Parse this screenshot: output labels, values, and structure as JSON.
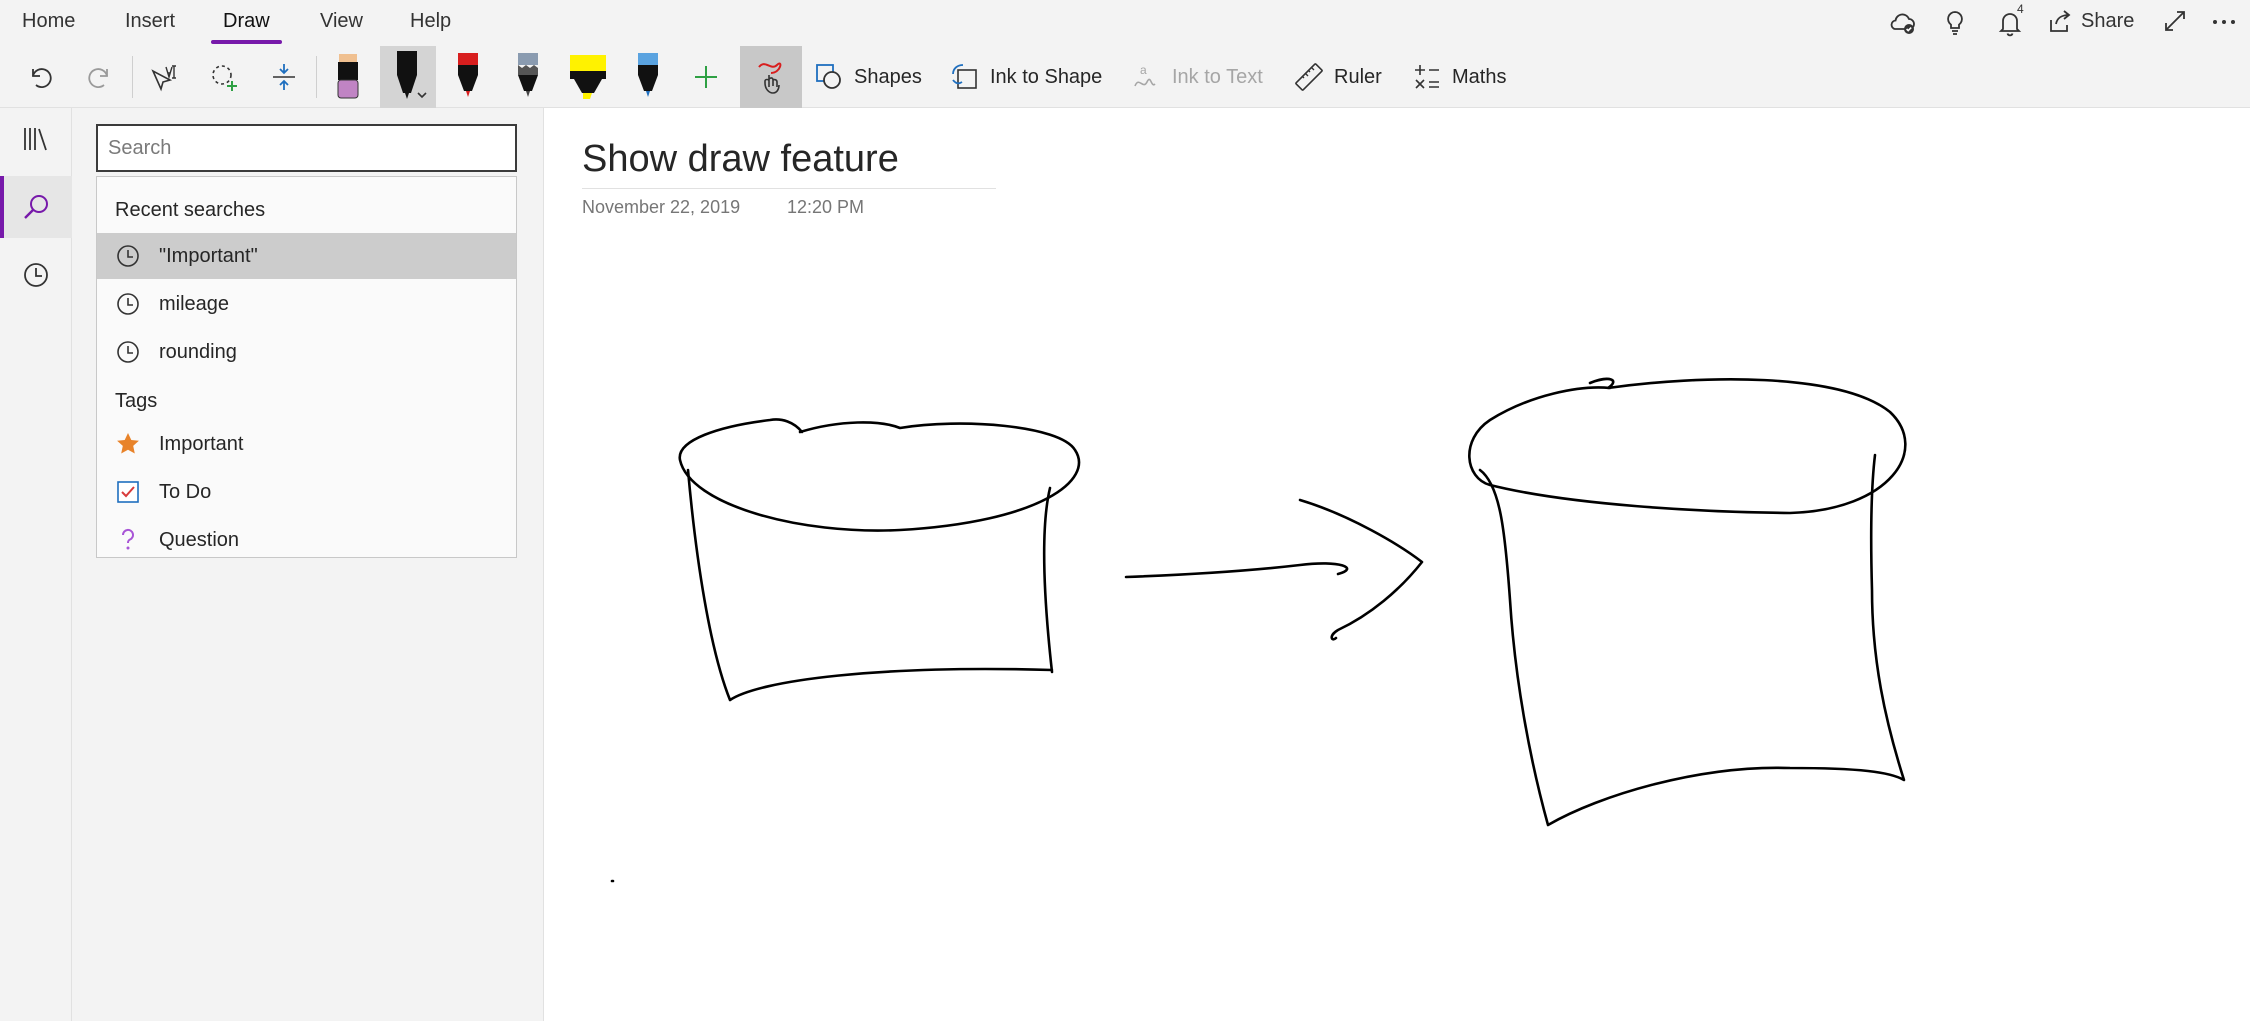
{
  "ribbon": {
    "tabs": [
      {
        "label": "Home"
      },
      {
        "label": "Insert"
      },
      {
        "label": "Draw",
        "active": true
      },
      {
        "label": "View"
      },
      {
        "label": "Help"
      }
    ],
    "notifications_count": "4",
    "share_label": "Share"
  },
  "toolbar": {
    "shapes_label": "Shapes",
    "ink_to_shape_label": "Ink to Shape",
    "ink_to_text_label": "Ink to Text",
    "ruler_label": "Ruler",
    "maths_label": "Maths",
    "pens": [
      {
        "name": "eraser",
        "color": "#c084c4"
      },
      {
        "name": "pen-black",
        "color": "#111111",
        "selected": true
      },
      {
        "name": "pen-red",
        "color": "#d81e1e"
      },
      {
        "name": "pen-galaxy",
        "color": "#4a4a4a"
      },
      {
        "name": "highlighter-yellow",
        "color": "#fff200"
      },
      {
        "name": "pen-blue",
        "color": "#1f6fbf"
      }
    ],
    "accent_color": "#7719aa"
  },
  "search": {
    "placeholder": "Search",
    "value": "",
    "recent_header": "Recent searches",
    "recent": [
      {
        "label": "\"Important\"",
        "icon": "clock-icon"
      },
      {
        "label": "mileage",
        "icon": "clock-icon"
      },
      {
        "label": "rounding",
        "icon": "clock-icon"
      }
    ],
    "tags_header": "Tags",
    "tags": [
      {
        "label": "Important",
        "icon": "star-icon",
        "color": "#e8832a"
      },
      {
        "label": "To Do",
        "icon": "checkbox-checked-icon",
        "color": "#d83b3b"
      },
      {
        "label": "Question",
        "icon": "question-icon",
        "color": "#a855d6"
      }
    ]
  },
  "page": {
    "title": "Show draw feature",
    "date": "November 22, 2019",
    "time": "12:20 PM"
  }
}
